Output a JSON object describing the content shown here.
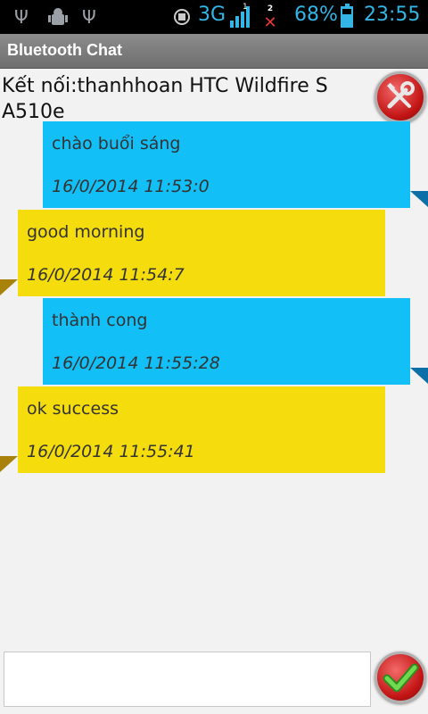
{
  "status_bar": {
    "icons": [
      "usb-icon",
      "android-debug-icon",
      "usb-icon"
    ],
    "network": "3G",
    "sim_indicator": "1",
    "no_signal_indicator": "2",
    "battery": "68%",
    "time": "23:55"
  },
  "app": {
    "title": "Bluetooth Chat"
  },
  "connection": {
    "text": "Kết nối:thanhhoan HTC Wildfire S A510e"
  },
  "messages": [
    {
      "direction": "out",
      "text": "chào buổi sáng",
      "time": "16/0/2014 11:53:0"
    },
    {
      "direction": "in",
      "text": "good morning",
      "time": "16/0/2014 11:54:7"
    },
    {
      "direction": "out",
      "text": "thành cong",
      "time": "16/0/2014 11:55:28"
    },
    {
      "direction": "in",
      "text": "ok success",
      "time": "16/0/2014 11:55:41"
    }
  ],
  "composer": {
    "value": ""
  },
  "colors": {
    "outgoing": "#12bff7",
    "incoming": "#f5dc0c",
    "accent": "#33b5e5"
  }
}
